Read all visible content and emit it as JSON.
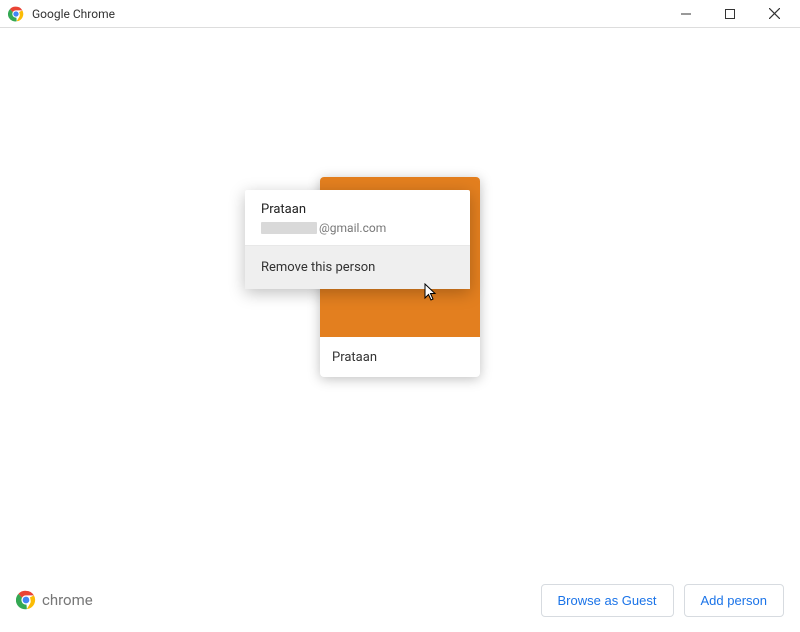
{
  "window": {
    "title": "Google Chrome"
  },
  "profile": {
    "display_name": "Prataan",
    "card_name": "Prataan",
    "email_suffix": "@gmail.com",
    "banner_color": "#e37f1f"
  },
  "menu": {
    "remove_label": "Remove this person"
  },
  "brand": {
    "word": "chrome"
  },
  "buttons": {
    "browse_guest": "Browse as Guest",
    "add_person": "Add person"
  }
}
